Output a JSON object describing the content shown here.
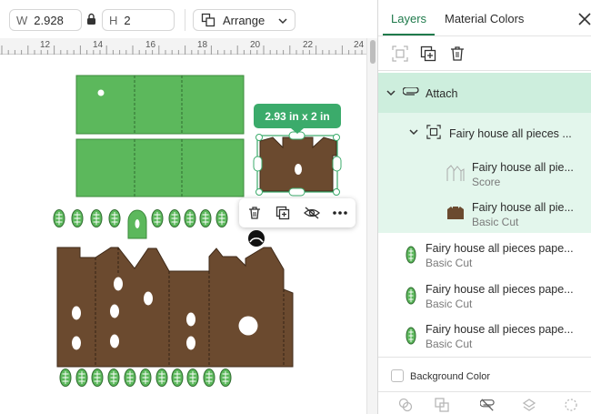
{
  "toolbar": {
    "width_label": "W",
    "width_value": "2.928",
    "height_label": "H",
    "height_value": "2",
    "arrange_label": "Arrange"
  },
  "ruler": {
    "ticks": [
      "12",
      "14",
      "16",
      "18",
      "20",
      "22",
      "24"
    ]
  },
  "canvas": {
    "size_badge": "2.93  in x 2  in"
  },
  "panel": {
    "tabs": [
      {
        "label": "Layers",
        "active": true
      },
      {
        "label": "Material Colors",
        "active": false
      }
    ],
    "layers": {
      "attach": {
        "label": "Attach"
      },
      "group": {
        "label": "Fairy house all pieces ..."
      },
      "children": [
        {
          "name": "Fairy house all pie...",
          "type": "Score"
        },
        {
          "name": "Fairy house all pie...",
          "type": "Basic Cut"
        }
      ],
      "items": [
        {
          "name": "Fairy house all pieces pape...",
          "type": "Basic Cut"
        },
        {
          "name": "Fairy house all pieces pape...",
          "type": "Basic Cut"
        },
        {
          "name": "Fairy house all pieces pape...",
          "type": "Basic Cut"
        }
      ]
    },
    "background_color_label": "Background Color"
  },
  "colors": {
    "green": "#5cb85c",
    "brown": "#6b4a2f",
    "accent": "#1f7a4b",
    "badge": "#3bab6b"
  }
}
